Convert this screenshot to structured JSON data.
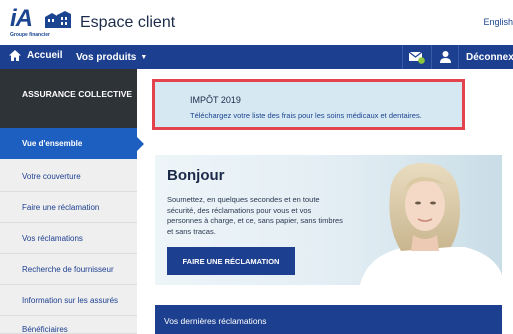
{
  "header": {
    "logo_text": "iA",
    "logo_subtext": "Groupe financier",
    "title": "Espace client",
    "language_link": "English"
  },
  "navbar": {
    "home_label": "Accueil",
    "products_label": "Vos produits",
    "logout_label": "Déconnexion"
  },
  "sidebar": {
    "heading": "ASSURANCE COLLECTIVE",
    "items": [
      {
        "label": "Vue d'ensemble"
      },
      {
        "label": "Votre couverture"
      },
      {
        "label": "Faire une réclamation"
      },
      {
        "label": "Vos réclamations"
      },
      {
        "label": "Recherche de fournisseur"
      },
      {
        "label": "Information sur les assurés"
      },
      {
        "label": "Bénéficiaires"
      }
    ]
  },
  "notice": {
    "title": "IMPÔT 2019",
    "link_text": "Téléchargez votre liste des frais pour les soins médicaux et dentaires."
  },
  "hero": {
    "title": "Bonjour",
    "text": "Soumettez, en quelques secondes et en toute sécurité, des réclamations pour vous et vos personnes à charge, et ce, sans papier, sans timbres et sans tracas.",
    "button_label": "FAIRE UNE RÉCLAMATION"
  },
  "claims": {
    "heading": "Vos dernières réclamations"
  },
  "colors": {
    "brand_blue": "#1c3f8f",
    "active_blue": "#1c5fc0",
    "sidebar_dark": "#2e3338",
    "notice_bg": "#d6e8f2",
    "notice_border": "#e2434c"
  }
}
